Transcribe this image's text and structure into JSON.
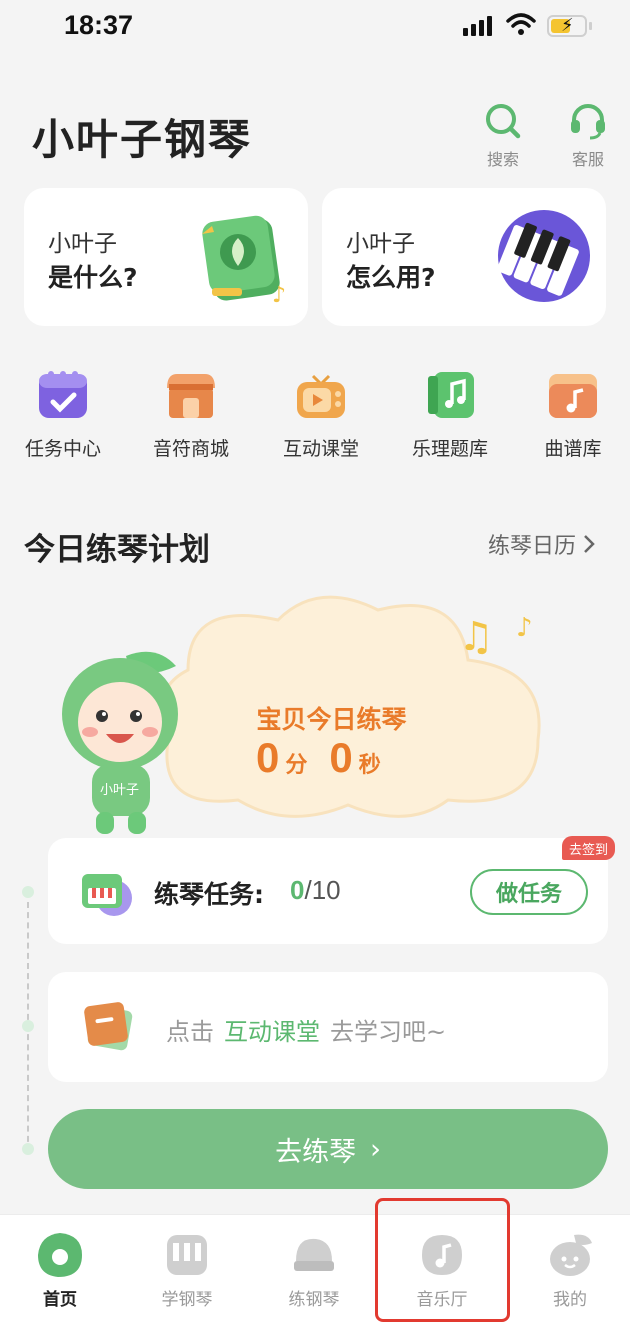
{
  "status_bar": {
    "time": "18:37"
  },
  "header": {
    "title": "小叶子钢琴",
    "search_label": "搜索",
    "service_label": "客服"
  },
  "intro_cards": [
    {
      "line1": "小叶子",
      "line2": "是什么?"
    },
    {
      "line1": "小叶子",
      "line2": "怎么用?"
    }
  ],
  "features": [
    {
      "label": "任务中心",
      "icon": "task-center-icon"
    },
    {
      "label": "音符商城",
      "icon": "note-mall-icon"
    },
    {
      "label": "互动课堂",
      "icon": "interactive-class-icon"
    },
    {
      "label": "乐理题库",
      "icon": "theory-bank-icon"
    },
    {
      "label": "曲谱库",
      "icon": "sheet-music-icon"
    }
  ],
  "plan": {
    "title": "今日练琴计划",
    "calendar_link": "练琴日历",
    "practice_title": "宝贝今日练琴",
    "minutes": "0",
    "minutes_unit": "分",
    "seconds": "0",
    "seconds_unit": "秒",
    "mascot_text": "小叶子"
  },
  "task": {
    "label": "练琴任务:",
    "done": "0",
    "total": "/10",
    "button": "做任务",
    "badge": "去签到"
  },
  "tip": {
    "prefix": "点击",
    "highlight": "互动课堂",
    "suffix": "去学习吧~"
  },
  "cta": {
    "label": "去练琴",
    "arrow": "›"
  },
  "tabs": [
    {
      "label": "首页",
      "icon": "home-icon",
      "active": true
    },
    {
      "label": "学钢琴",
      "icon": "learn-piano-icon",
      "active": false
    },
    {
      "label": "练钢琴",
      "icon": "practice-piano-icon",
      "active": false
    },
    {
      "label": "音乐厅",
      "icon": "music-hall-icon",
      "active": false
    },
    {
      "label": "我的",
      "icon": "profile-icon",
      "active": false
    }
  ],
  "colors": {
    "brand_green": "#5cb870",
    "cta_green": "#79bf86",
    "practice_orange": "#e97b2a",
    "highlight_red": "#e23a30"
  }
}
